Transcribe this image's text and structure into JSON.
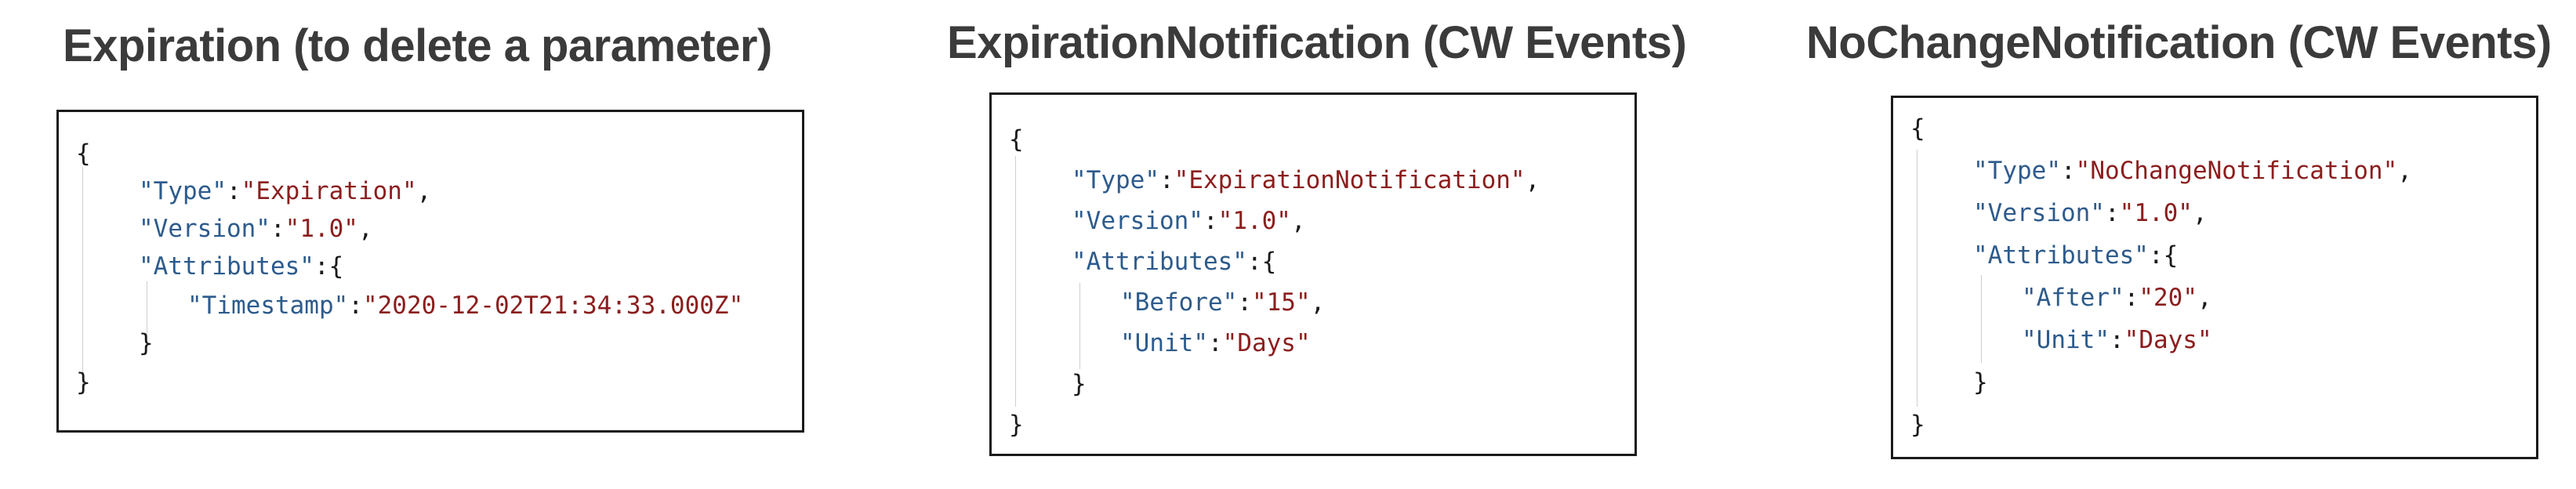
{
  "panels": [
    {
      "title": "Expiration (to delete a parameter)",
      "open_brace": "{",
      "close_brace": "}",
      "fields": [
        {
          "key": "\"Type\"",
          "sep": ":",
          "value": "\"Expiration\"",
          "trail": ","
        },
        {
          "key": "\"Version\"",
          "sep": ":",
          "value": "\"1.0\"",
          "trail": ","
        },
        {
          "key": "\"Attributes\"",
          "sep": ":",
          "value": "",
          "trail": "{"
        }
      ],
      "attributes": [
        {
          "key": "\"Timestamp\"",
          "sep": ":",
          "value": "\"2020-12-02T21:34:33.000Z\"",
          "trail": ""
        }
      ],
      "attributes_close": "}"
    },
    {
      "title": "ExpirationNotification (CW Events)",
      "open_brace": "{",
      "close_brace": "}",
      "fields": [
        {
          "key": "\"Type\"",
          "sep": ":",
          "value": "\"ExpirationNotification\"",
          "trail": ","
        },
        {
          "key": "\"Version\"",
          "sep": ":",
          "value": "\"1.0\"",
          "trail": ","
        },
        {
          "key": "\"Attributes\"",
          "sep": ":",
          "value": "",
          "trail": "{"
        }
      ],
      "attributes": [
        {
          "key": "\"Before\"",
          "sep": ":",
          "value": "\"15\"",
          "trail": ","
        },
        {
          "key": "\"Unit\"",
          "sep": ":",
          "value": "\"Days\"",
          "trail": ""
        }
      ],
      "attributes_close": "}"
    },
    {
      "title": "NoChangeNotification (CW Events)",
      "open_brace": "{",
      "close_brace": "}",
      "fields": [
        {
          "key": "\"Type\"",
          "sep": ":",
          "value": "\"NoChangeNotification\"",
          "trail": ","
        },
        {
          "key": "\"Version\"",
          "sep": ":",
          "value": "\"1.0\"",
          "trail": ","
        },
        {
          "key": "\"Attributes\"",
          "sep": ":",
          "value": "",
          "trail": "{"
        }
      ],
      "attributes": [
        {
          "key": "\"After\"",
          "sep": ":",
          "value": "\"20\"",
          "trail": ","
        },
        {
          "key": "\"Unit\"",
          "sep": ":",
          "value": "\"Days\"",
          "trail": ""
        }
      ],
      "attributes_close": "}"
    }
  ],
  "colors": {
    "title": "#3b3b3b",
    "key": "#2d5b8c",
    "string": "#8b1e1e",
    "punctuation": "#1a1a1a",
    "border": "#1a1a1a"
  }
}
